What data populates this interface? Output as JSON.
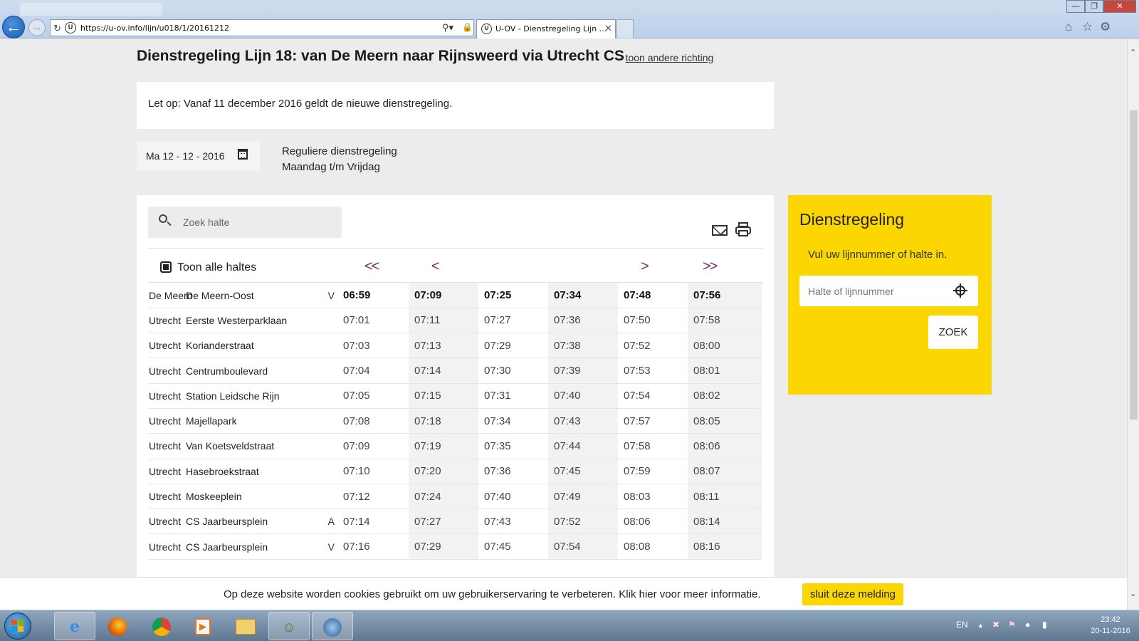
{
  "browser": {
    "url": "https://u-ov.info/lijn/u018/1/20161212",
    "tab_title": "U-OV - Dienstregeling Lijn ...",
    "favicon": "U"
  },
  "page": {
    "title": "Dienstregeling Lijn 18: van De Meern naar Rijnsweerd via Utrecht CS",
    "title_link_prefix": "- ",
    "title_link": "toon andere richting",
    "notice": "Let op: Vanaf 11 december 2016 geldt de nieuwe dienstregeling.",
    "date": "Ma 12 - 12 - 2016",
    "schedule_type": "Reguliere dienstregeling",
    "schedule_days": "Maandag t/m Vrijdag",
    "search_placeholder": "Zoek halte",
    "toggle_label": "Toon alle haltes",
    "nav": {
      "first": "<<",
      "prev": "<",
      "next": ">",
      "last": ">>"
    }
  },
  "timetable": {
    "rows": [
      {
        "city": "De Meern",
        "stop": "De Meern-Oost",
        "flag": "V",
        "times": [
          "06:59",
          "07:09",
          "07:25",
          "07:34",
          "07:48",
          "07:56"
        ]
      },
      {
        "city": "Utrecht",
        "stop": "Eerste Westerparklaan",
        "flag": "",
        "times": [
          "07:01",
          "07:11",
          "07:27",
          "07:36",
          "07:50",
          "07:58"
        ]
      },
      {
        "city": "Utrecht",
        "stop": "Korianderstraat",
        "flag": "",
        "times": [
          "07:03",
          "07:13",
          "07:29",
          "07:38",
          "07:52",
          "08:00"
        ]
      },
      {
        "city": "Utrecht",
        "stop": "Centrumboulevard",
        "flag": "",
        "times": [
          "07:04",
          "07:14",
          "07:30",
          "07:39",
          "07:53",
          "08:01"
        ]
      },
      {
        "city": "Utrecht",
        "stop": "Station Leidsche Rijn",
        "flag": "",
        "times": [
          "07:05",
          "07:15",
          "07:31",
          "07:40",
          "07:54",
          "08:02"
        ]
      },
      {
        "city": "Utrecht",
        "stop": "Majellapark",
        "flag": "",
        "times": [
          "07:08",
          "07:18",
          "07:34",
          "07:43",
          "07:57",
          "08:05"
        ]
      },
      {
        "city": "Utrecht",
        "stop": "Van Koetsveldstraat",
        "flag": "",
        "times": [
          "07:09",
          "07:19",
          "07:35",
          "07:44",
          "07:58",
          "08:06"
        ]
      },
      {
        "city": "Utrecht",
        "stop": "Hasebroekstraat",
        "flag": "",
        "times": [
          "07:10",
          "07:20",
          "07:36",
          "07:45",
          "07:59",
          "08:07"
        ]
      },
      {
        "city": "Utrecht",
        "stop": "Moskeeplein",
        "flag": "",
        "times": [
          "07:12",
          "07:24",
          "07:40",
          "07:49",
          "08:03",
          "08:11"
        ]
      },
      {
        "city": "Utrecht",
        "stop": "CS Jaarbeursplein",
        "flag": "A",
        "times": [
          "07:14",
          "07:27",
          "07:43",
          "07:52",
          "08:06",
          "08:14"
        ]
      },
      {
        "city": "Utrecht",
        "stop": "CS Jaarbeursplein",
        "flag": "V",
        "times": [
          "07:16",
          "07:29",
          "07:45",
          "07:54",
          "08:08",
          "08:16"
        ]
      }
    ]
  },
  "sidebar": {
    "title": "Dienstregeling",
    "subtitle": "Vul uw lijnnummer of halte in.",
    "input_placeholder": "Halte of lijnnummer",
    "button": "ZOEK"
  },
  "cookie": {
    "text": "Op deze website worden cookies gebruikt om uw gebruikerservaring te verbeteren. Klik hier voor meer informatie.",
    "button": "sluit deze melding"
  },
  "taskbar": {
    "language": "EN",
    "time": "23:42",
    "date": "20-11-2016",
    "apps": [
      "internet-explorer",
      "firefox",
      "chrome",
      "media-player",
      "file-explorer",
      "users",
      "network"
    ]
  },
  "colors": {
    "accent_yellow": "#fcd600",
    "nav_arrow": "#7a2d63"
  }
}
